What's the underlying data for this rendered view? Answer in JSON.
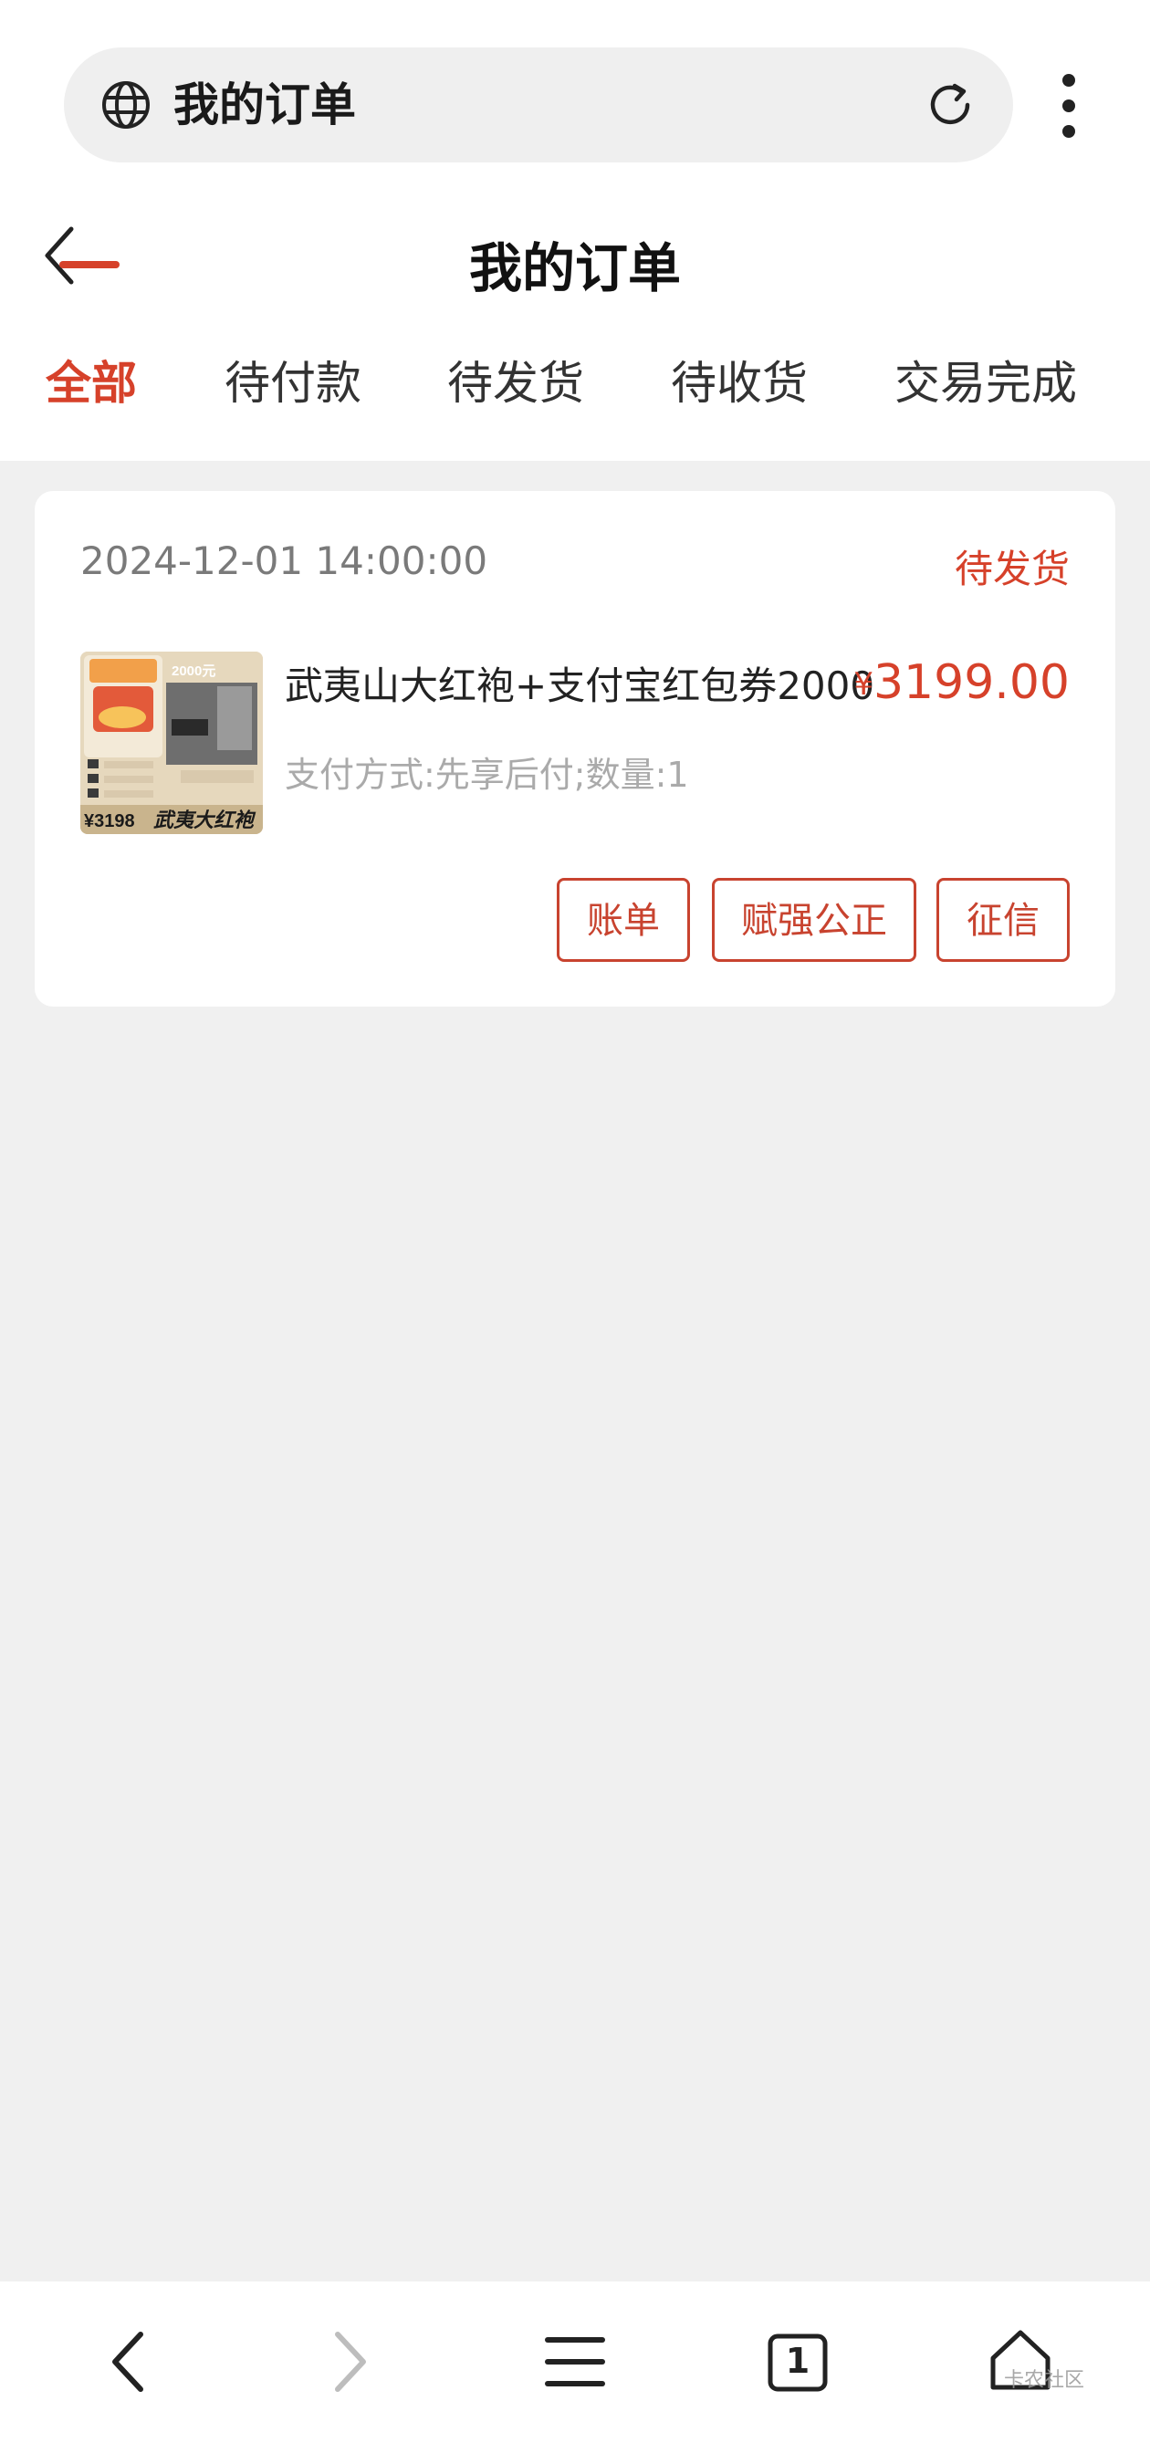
{
  "browser": {
    "url_title": "我的订单",
    "tab_count": "1"
  },
  "header": {
    "title": "我的订单"
  },
  "tabs": [
    {
      "label": "全部",
      "active": true
    },
    {
      "label": "待付款",
      "active": false
    },
    {
      "label": "待发货",
      "active": false
    },
    {
      "label": "待收货",
      "active": false
    },
    {
      "label": "交易完成",
      "active": false
    }
  ],
  "order": {
    "date": "2024-12-01 14:00:00",
    "status": "待发货",
    "product_name": "武夷山大红袍+支付宝红包券2000",
    "currency": "¥",
    "price": "3199.00",
    "meta": "支付方式:先享后付;数量:1",
    "actions": [
      "账单",
      "赋强公正",
      "征信"
    ],
    "image": {
      "top_badge": "2000元",
      "price_label": "¥3198",
      "brand_text": "武夷大红袍"
    }
  },
  "watermark": "卡农社区",
  "colors": {
    "accent": "#d6412a",
    "background": "#f0f0f0",
    "card": "#ffffff"
  }
}
